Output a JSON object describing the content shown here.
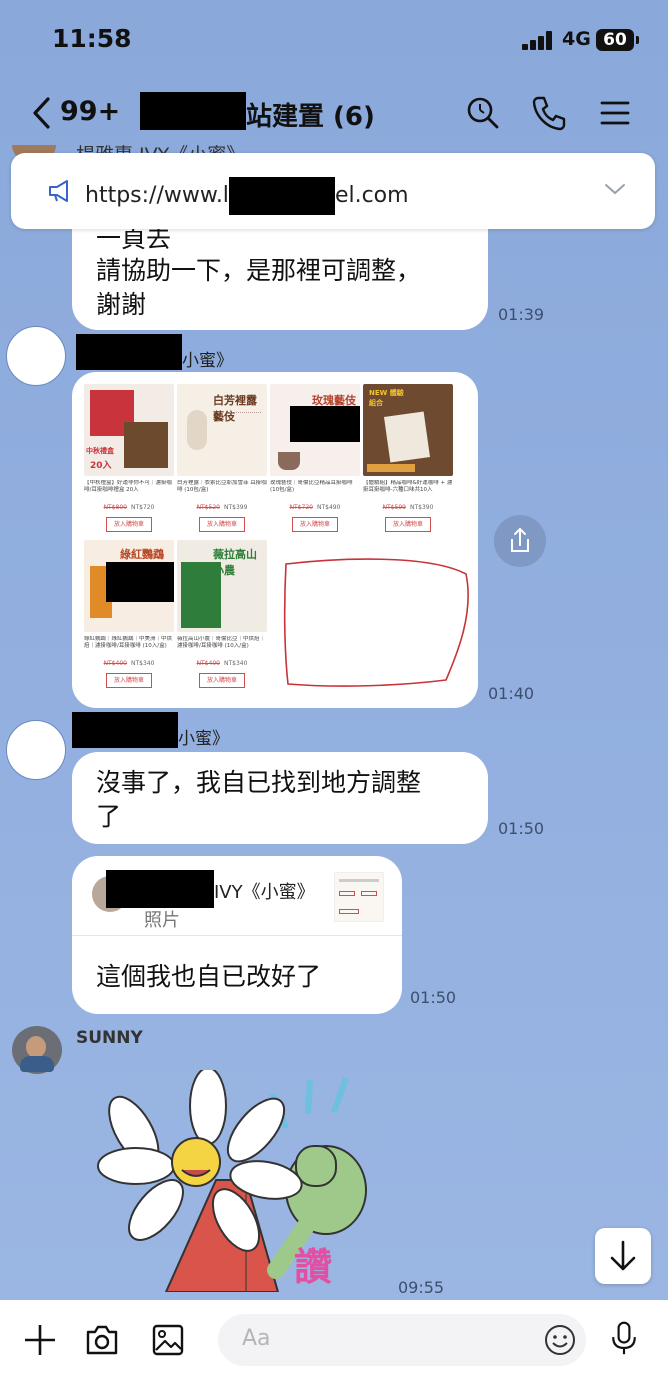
{
  "status_bar": {
    "time": "11:58",
    "network": "4G",
    "battery": "60"
  },
  "header": {
    "unread_count": "99+",
    "title_visible": "站建置 (6)"
  },
  "announcement": {
    "url_start": "https://www.l",
    "url_end": "el.com"
  },
  "partial_sender": "楊雅惠 IVY《小蜜》",
  "messages": [
    {
      "id": "m1",
      "lines": [
        "一頁去",
        "請協助一下，是那裡可調整，",
        "謝謝"
      ],
      "time": "01:39"
    },
    {
      "id": "m2",
      "sender_suffix": "小蜜》",
      "time": "01:40"
    },
    {
      "id": "m3",
      "sender_suffix": "小蜜》",
      "lines": [
        "沒事了，我自已找到地方調整",
        "了"
      ],
      "time": "01:50"
    },
    {
      "id": "m4",
      "reply_sender": "IVY《小蜜》",
      "reply_type": "照片",
      "text": "這個我也自已改好了",
      "time": "01:50"
    },
    {
      "id": "m5",
      "sender": "SUNNY",
      "sticker_text": "讚",
      "time": "09:55"
    }
  ],
  "products": [
    {
      "title": "中秋禮盒",
      "badge": "20入",
      "name": "【中秋禮盒】好運非你不可｜濾掛咖啡/耳掛咖啡禮盒 20入",
      "old_price": "NT$800",
      "price": "NT$720",
      "button": "放入購物車",
      "color": "#c8333c"
    },
    {
      "title": "白芳裡露藝伎",
      "badge": "",
      "name": "白芳裡露｜衣索比亞耶加雪菲 耳掛咖啡 (10包/盒)",
      "old_price": "NT$520",
      "price": "NT$399",
      "button": "放入購物車",
      "color": "#6b3a22"
    },
    {
      "title": "玫瑰藝伎",
      "badge": "",
      "name": "玫瑰藝伎｜哥倫比亞精品耳掛咖啡 (10包/盒)",
      "old_price": "NT$720",
      "price": "NT$490",
      "button": "放入購物車",
      "color": "#b4442f"
    },
    {
      "title": "NEW 體驗組合",
      "badge": "",
      "name": "【體驗組】精品咖啡&好運咖啡 + 濾掛耳掛咖啡-六種口味共10入",
      "old_price": "NT$599",
      "price": "NT$390",
      "button": "放入購物車",
      "color": "#8a5a34"
    },
    {
      "title": "綠紅鸚鵡",
      "badge": "",
      "name": "綠紅鸚鵡｜綠紅鸚鵡｜中美洲｜中烘焙｜濾掛咖啡/耳掛咖啡 (10入/盒)",
      "old_price": "NT$400",
      "price": "NT$340",
      "button": "放入購物車",
      "color": "#e08a28"
    },
    {
      "title": "薇拉高山小農",
      "badge": "",
      "name": "薇拉高山小農｜哥倫比亞｜中烘焙｜濾掛咖啡/耳掛咖啡 (10入/盒)",
      "old_price": "NT$400",
      "price": "NT$340",
      "button": "放入購物車",
      "color": "#2e7d3a"
    }
  ],
  "input": {
    "placeholder": "Aa"
  },
  "colors": {
    "chat_bg": "#8fadde",
    "bubble": "#ffffff",
    "accent_red": "#d24d4d",
    "brand_blue": "#3a63c7"
  }
}
